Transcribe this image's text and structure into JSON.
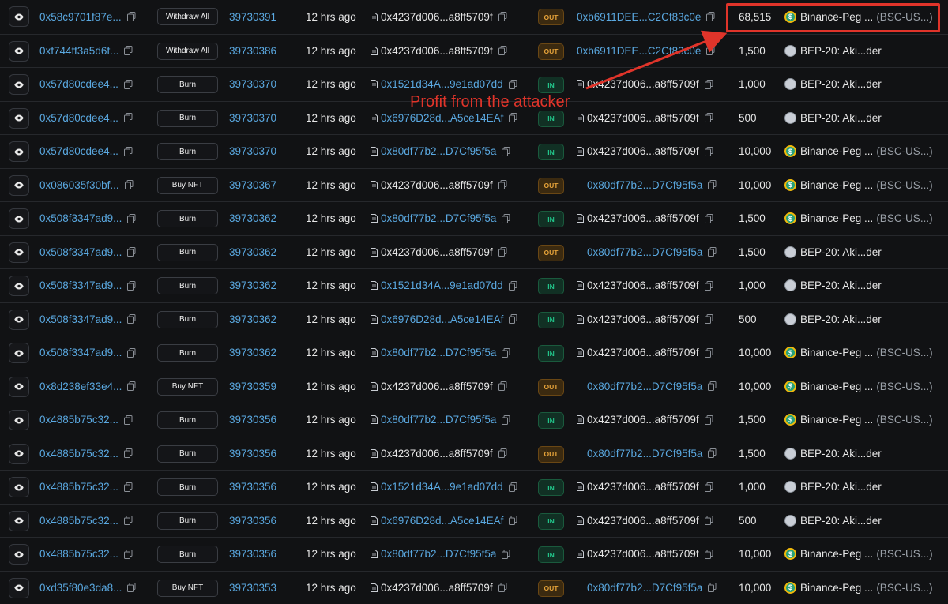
{
  "annotation": {
    "text": "Profit from the attacker",
    "color": "#e0342a"
  },
  "colors": {
    "background": "#111214",
    "link": "#5aa8e0",
    "out_badge": "#e6a33a",
    "in_badge": "#22c58a"
  },
  "icons": {
    "view": "eye-icon",
    "copy": "copy-icon",
    "contract": "document-icon",
    "usdt": "usdt-token-icon",
    "bep20": "bep20-token-icon"
  },
  "rows": [
    {
      "hash": "0x58c9701f87e...",
      "method": "Withdraw All",
      "block": "39730391",
      "age": "12 hrs ago",
      "from": "0x4237d006...a8ff5709f",
      "from_link": false,
      "dir": "OUT",
      "to": "0xb6911DEE...C2Cf83c0e",
      "to_link": true,
      "amount": "68,515",
      "token": "Binance-Peg ...",
      "symbol": "(BSC-US...)",
      "token_type": "usdt"
    },
    {
      "hash": "0xf744ff3a5d6f...",
      "method": "Withdraw All",
      "block": "39730386",
      "age": "12 hrs ago",
      "from": "0x4237d006...a8ff5709f",
      "from_link": false,
      "dir": "OUT",
      "to": "0xb6911DEE...C2Cf83c0e",
      "to_link": true,
      "amount": "1,500",
      "token": "BEP-20: Aki...der",
      "symbol": "",
      "token_type": "bep"
    },
    {
      "hash": "0x57d80cdee4...",
      "method": "Burn",
      "block": "39730370",
      "age": "12 hrs ago",
      "from": "0x1521d34A...9e1ad07dd",
      "from_link": true,
      "dir": "IN",
      "to": "0x4237d006...a8ff5709f",
      "to_link": false,
      "amount": "1,000",
      "token": "BEP-20: Aki...der",
      "symbol": "",
      "token_type": "bep"
    },
    {
      "hash": "0x57d80cdee4...",
      "method": "Burn",
      "block": "39730370",
      "age": "12 hrs ago",
      "from": "0x6976D28d...A5ce14EAf",
      "from_link": true,
      "dir": "IN",
      "to": "0x4237d006...a8ff5709f",
      "to_link": false,
      "amount": "500",
      "token": "BEP-20: Aki...der",
      "symbol": "",
      "token_type": "bep"
    },
    {
      "hash": "0x57d80cdee4...",
      "method": "Burn",
      "block": "39730370",
      "age": "12 hrs ago",
      "from": "0x80df77b2...D7Cf95f5a",
      "from_link": true,
      "dir": "IN",
      "to": "0x4237d006...a8ff5709f",
      "to_link": false,
      "amount": "10,000",
      "token": "Binance-Peg ...",
      "symbol": "(BSC-US...)",
      "token_type": "usdt"
    },
    {
      "hash": "0x086035f30bf...",
      "method": "Buy NFT",
      "block": "39730367",
      "age": "12 hrs ago",
      "from": "0x4237d006...a8ff5709f",
      "from_link": false,
      "dir": "OUT",
      "to": "0x80df77b2...D7Cf95f5a",
      "to_link": true,
      "amount": "10,000",
      "token": "Binance-Peg ...",
      "symbol": "(BSC-US...)",
      "token_type": "usdt"
    },
    {
      "hash": "0x508f3347ad9...",
      "method": "Burn",
      "block": "39730362",
      "age": "12 hrs ago",
      "from": "0x80df77b2...D7Cf95f5a",
      "from_link": true,
      "dir": "IN",
      "to": "0x4237d006...a8ff5709f",
      "to_link": false,
      "amount": "1,500",
      "token": "Binance-Peg ...",
      "symbol": "(BSC-US...)",
      "token_type": "usdt"
    },
    {
      "hash": "0x508f3347ad9...",
      "method": "Burn",
      "block": "39730362",
      "age": "12 hrs ago",
      "from": "0x4237d006...a8ff5709f",
      "from_link": false,
      "dir": "OUT",
      "to": "0x80df77b2...D7Cf95f5a",
      "to_link": true,
      "amount": "1,500",
      "token": "BEP-20: Aki...der",
      "symbol": "",
      "token_type": "bep"
    },
    {
      "hash": "0x508f3347ad9...",
      "method": "Burn",
      "block": "39730362",
      "age": "12 hrs ago",
      "from": "0x1521d34A...9e1ad07dd",
      "from_link": true,
      "dir": "IN",
      "to": "0x4237d006...a8ff5709f",
      "to_link": false,
      "amount": "1,000",
      "token": "BEP-20: Aki...der",
      "symbol": "",
      "token_type": "bep"
    },
    {
      "hash": "0x508f3347ad9...",
      "method": "Burn",
      "block": "39730362",
      "age": "12 hrs ago",
      "from": "0x6976D28d...A5ce14EAf",
      "from_link": true,
      "dir": "IN",
      "to": "0x4237d006...a8ff5709f",
      "to_link": false,
      "amount": "500",
      "token": "BEP-20: Aki...der",
      "symbol": "",
      "token_type": "bep"
    },
    {
      "hash": "0x508f3347ad9...",
      "method": "Burn",
      "block": "39730362",
      "age": "12 hrs ago",
      "from": "0x80df77b2...D7Cf95f5a",
      "from_link": true,
      "dir": "IN",
      "to": "0x4237d006...a8ff5709f",
      "to_link": false,
      "amount": "10,000",
      "token": "Binance-Peg ...",
      "symbol": "(BSC-US...)",
      "token_type": "usdt"
    },
    {
      "hash": "0x8d238ef33e4...",
      "method": "Buy NFT",
      "block": "39730359",
      "age": "12 hrs ago",
      "from": "0x4237d006...a8ff5709f",
      "from_link": false,
      "dir": "OUT",
      "to": "0x80df77b2...D7Cf95f5a",
      "to_link": true,
      "amount": "10,000",
      "token": "Binance-Peg ...",
      "symbol": "(BSC-US...)",
      "token_type": "usdt"
    },
    {
      "hash": "0x4885b75c32...",
      "method": "Burn",
      "block": "39730356",
      "age": "12 hrs ago",
      "from": "0x80df77b2...D7Cf95f5a",
      "from_link": true,
      "dir": "IN",
      "to": "0x4237d006...a8ff5709f",
      "to_link": false,
      "amount": "1,500",
      "token": "Binance-Peg ...",
      "symbol": "(BSC-US...)",
      "token_type": "usdt"
    },
    {
      "hash": "0x4885b75c32...",
      "method": "Burn",
      "block": "39730356",
      "age": "12 hrs ago",
      "from": "0x4237d006...a8ff5709f",
      "from_link": false,
      "dir": "OUT",
      "to": "0x80df77b2...D7Cf95f5a",
      "to_link": true,
      "amount": "1,500",
      "token": "BEP-20: Aki...der",
      "symbol": "",
      "token_type": "bep"
    },
    {
      "hash": "0x4885b75c32...",
      "method": "Burn",
      "block": "39730356",
      "age": "12 hrs ago",
      "from": "0x1521d34A...9e1ad07dd",
      "from_link": true,
      "dir": "IN",
      "to": "0x4237d006...a8ff5709f",
      "to_link": false,
      "amount": "1,000",
      "token": "BEP-20: Aki...der",
      "symbol": "",
      "token_type": "bep"
    },
    {
      "hash": "0x4885b75c32...",
      "method": "Burn",
      "block": "39730356",
      "age": "12 hrs ago",
      "from": "0x6976D28d...A5ce14EAf",
      "from_link": true,
      "dir": "IN",
      "to": "0x4237d006...a8ff5709f",
      "to_link": false,
      "amount": "500",
      "token": "BEP-20: Aki...der",
      "symbol": "",
      "token_type": "bep"
    },
    {
      "hash": "0x4885b75c32...",
      "method": "Burn",
      "block": "39730356",
      "age": "12 hrs ago",
      "from": "0x80df77b2...D7Cf95f5a",
      "from_link": true,
      "dir": "IN",
      "to": "0x4237d006...a8ff5709f",
      "to_link": false,
      "amount": "10,000",
      "token": "Binance-Peg ...",
      "symbol": "(BSC-US...)",
      "token_type": "usdt"
    },
    {
      "hash": "0xd35f80e3da8...",
      "method": "Buy NFT",
      "block": "39730353",
      "age": "12 hrs ago",
      "from": "0x4237d006...a8ff5709f",
      "from_link": false,
      "dir": "OUT",
      "to": "0x80df77b2...D7Cf95f5a",
      "to_link": true,
      "amount": "10,000",
      "token": "Binance-Peg ...",
      "symbol": "(BSC-US...)",
      "token_type": "usdt"
    }
  ]
}
